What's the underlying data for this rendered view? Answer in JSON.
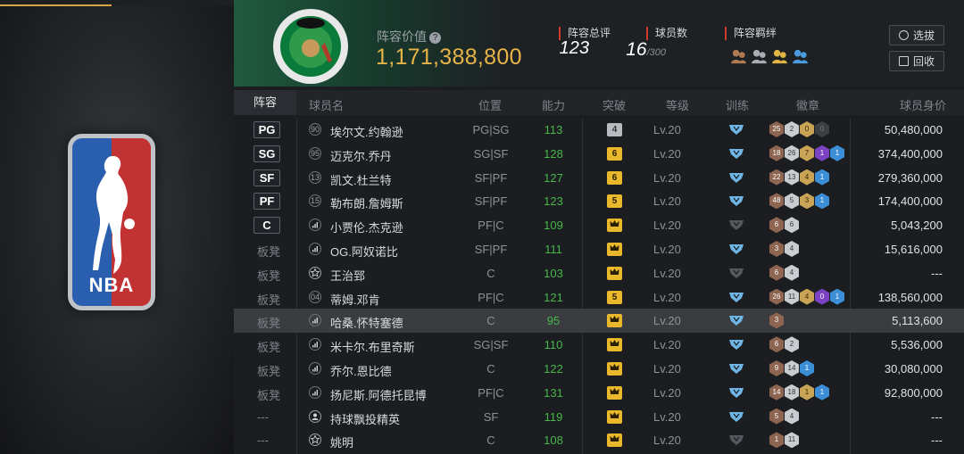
{
  "header": {
    "lineup_value_label": "阵容价值",
    "lineup_value": "1,171,388,800",
    "rating_label": "阵容总评",
    "rating_value": "123",
    "players_label": "球员数",
    "players_value": "16",
    "players_max": "/300",
    "bonds_label": "阵容羁绊",
    "select_button": "选拔",
    "recycle_button": "回收",
    "team_logo": "celtics-logo"
  },
  "left_logo": {
    "text": "NBA"
  },
  "columns": {
    "lineup": "阵容",
    "player": "球员名",
    "position": "位置",
    "ability": "能力",
    "breakthrough": "突破",
    "level": "等级",
    "training": "训练",
    "badges": "徽章",
    "value": "球员身价"
  },
  "rows": [
    {
      "slot": "PG",
      "starter": true,
      "num": "90",
      "name": "埃尔文.约翰逊",
      "pos": "PG|SG",
      "ability": "113",
      "brk": "4",
      "brk_style": "gray",
      "level": "Lv.20",
      "train": "blue",
      "badges": [
        [
          "25",
          "br"
        ],
        [
          "2",
          "sv"
        ],
        [
          "0",
          "gd"
        ],
        [
          "0",
          "dk"
        ]
      ],
      "value": "50,480,000"
    },
    {
      "slot": "SG",
      "starter": true,
      "num": "95",
      "name": "迈克尔.乔丹",
      "pos": "SG|SF",
      "ability": "128",
      "brk": "6",
      "brk_style": "yellow",
      "level": "Lv.20",
      "train": "blue",
      "badges": [
        [
          "18",
          "br"
        ],
        [
          "26",
          "sv"
        ],
        [
          "7",
          "gd"
        ],
        [
          "1",
          "pu"
        ],
        [
          "1",
          "bl"
        ]
      ],
      "value": "374,400,000"
    },
    {
      "slot": "SF",
      "starter": true,
      "num": "13",
      "name": "凯文.杜兰特",
      "pos": "SF|PF",
      "ability": "127",
      "brk": "6",
      "brk_style": "yellow",
      "level": "Lv.20",
      "train": "blue",
      "badges": [
        [
          "22",
          "br"
        ],
        [
          "13",
          "sv"
        ],
        [
          "4",
          "gd"
        ],
        [
          "1",
          "bl"
        ]
      ],
      "value": "279,360,000"
    },
    {
      "slot": "PF",
      "starter": true,
      "num": "15",
      "name": "勒布朗.詹姆斯",
      "pos": "SF|PF",
      "ability": "123",
      "brk": "5",
      "brk_style": "yellow",
      "level": "Lv.20",
      "train": "blue",
      "badges": [
        [
          "48",
          "br"
        ],
        [
          "5",
          "sv"
        ],
        [
          "3",
          "gd"
        ],
        [
          "1",
          "bl"
        ]
      ],
      "value": "174,400,000"
    },
    {
      "slot": "C",
      "starter": true,
      "num": "",
      "name": "小贾伦.杰克逊",
      "pos": "PF|C",
      "ability": "109",
      "brk": "crown",
      "brk_style": "yellow",
      "level": "Lv.20",
      "train": "gray",
      "badges": [
        [
          "6",
          "br"
        ],
        [
          "6",
          "sv"
        ]
      ],
      "value": "5,043,200"
    },
    {
      "slot": "板凳",
      "starter": false,
      "num": "",
      "name": "OG.阿奴诺比",
      "pos": "SF|PF",
      "ability": "111",
      "brk": "crown",
      "brk_style": "yellow",
      "level": "Lv.20",
      "train": "blue",
      "badges": [
        [
          "3",
          "br"
        ],
        [
          "4",
          "sv"
        ]
      ],
      "value": "15,616,000"
    },
    {
      "slot": "板凳",
      "starter": false,
      "num": "star",
      "name": "王治郅",
      "pos": "C",
      "ability": "103",
      "brk": "crown",
      "brk_style": "yellow",
      "level": "Lv.20",
      "train": "gray",
      "badges": [
        [
          "6",
          "br"
        ],
        [
          "4",
          "sv"
        ]
      ],
      "value": "---"
    },
    {
      "slot": "板凳",
      "starter": false,
      "num": "04",
      "name": "蒂姆.邓肯",
      "pos": "PF|C",
      "ability": "121",
      "brk": "5",
      "brk_style": "yellow",
      "level": "Lv.20",
      "train": "blue",
      "badges": [
        [
          "26",
          "br"
        ],
        [
          "11",
          "sv"
        ],
        [
          "4",
          "gd"
        ],
        [
          "0",
          "pu"
        ],
        [
          "1",
          "bl"
        ]
      ],
      "value": "138,560,000"
    },
    {
      "slot": "板凳",
      "starter": false,
      "num": "",
      "name": "哈桑.怀特塞德",
      "pos": "C",
      "ability": "95",
      "brk": "crown",
      "brk_style": "yellow",
      "level": "Lv.20",
      "train": "blue",
      "badges": [
        [
          "3",
          "br"
        ]
      ],
      "value": "5,113,600",
      "selected": true
    },
    {
      "slot": "板凳",
      "starter": false,
      "num": "",
      "name": "米卡尔.布里奇斯",
      "pos": "SG|SF",
      "ability": "110",
      "brk": "crown",
      "brk_style": "yellow",
      "level": "Lv.20",
      "train": "blue",
      "badges": [
        [
          "6",
          "br"
        ],
        [
          "2",
          "sv"
        ]
      ],
      "value": "5,536,000"
    },
    {
      "slot": "板凳",
      "starter": false,
      "num": "",
      "name": "乔尔.恩比德",
      "pos": "C",
      "ability": "122",
      "brk": "crown",
      "brk_style": "yellow",
      "level": "Lv.20",
      "train": "blue",
      "badges": [
        [
          "9",
          "br"
        ],
        [
          "14",
          "sv"
        ],
        [
          "1",
          "bl"
        ]
      ],
      "value": "30,080,000"
    },
    {
      "slot": "板凳",
      "starter": false,
      "num": "",
      "name": "扬尼斯.阿德托昆博",
      "pos": "PF|C",
      "ability": "131",
      "brk": "crown",
      "brk_style": "yellow",
      "level": "Lv.20",
      "train": "blue",
      "badges": [
        [
          "14",
          "br"
        ],
        [
          "18",
          "sv"
        ],
        [
          "1",
          "gd"
        ],
        [
          "1",
          "bl"
        ]
      ],
      "value": "92,800,000"
    },
    {
      "slot": "---",
      "starter": false,
      "num": "person",
      "name": "持球飘投精英",
      "pos": "SF",
      "ability": "119",
      "brk": "crown",
      "brk_style": "yellow",
      "level": "Lv.20",
      "train": "blue",
      "badges": [
        [
          "5",
          "br"
        ],
        [
          "4",
          "sv"
        ]
      ],
      "value": "---"
    },
    {
      "slot": "---",
      "starter": false,
      "num": "star",
      "name": "姚明",
      "pos": "C",
      "ability": "108",
      "brk": "crown",
      "brk_style": "yellow",
      "level": "Lv.20",
      "train": "gray",
      "badges": [
        [
          "1",
          "br"
        ],
        [
          "11",
          "sv"
        ]
      ],
      "value": "---"
    }
  ]
}
